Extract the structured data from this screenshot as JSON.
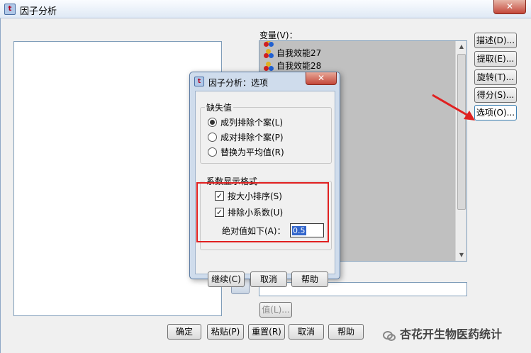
{
  "main_window": {
    "title": "因子分析",
    "close_glyph": "✕",
    "variables_label": "变量(V)：",
    "variables": [
      "自我效能27",
      "自我效能28"
    ],
    "side_buttons": [
      "描述(D)...",
      "提取(E)...",
      "旋转(T)...",
      "得分(S)...",
      "选项(O)..."
    ],
    "value_button": "值(L)...",
    "bottom_buttons": [
      "确定",
      "粘贴(P)",
      "重置(R)",
      "取消",
      "帮助"
    ]
  },
  "options_dialog": {
    "title": "因子分析：选项",
    "close_glyph": "✕",
    "missing_values": {
      "title": "缺失值",
      "options": [
        "成列排除个案(L)",
        "成对排除个案(P)",
        "替换为平均值(R)"
      ],
      "selected_index": 0
    },
    "coef_format": {
      "title": "系数显示格式",
      "sort_by_size": {
        "label": "按大小排序(S)",
        "checked": true
      },
      "suppress_small": {
        "label": "排除小系数(U)",
        "checked": true
      },
      "abs_value_label": "绝对值如下(A)：",
      "abs_value": "0.5"
    },
    "buttons": [
      "继续(C)",
      "取消",
      "帮助"
    ]
  },
  "watermark": "杏花开生物医药统计",
  "colors": {
    "annotation_red": "#e02020",
    "accent_blue": "#3366cc"
  }
}
